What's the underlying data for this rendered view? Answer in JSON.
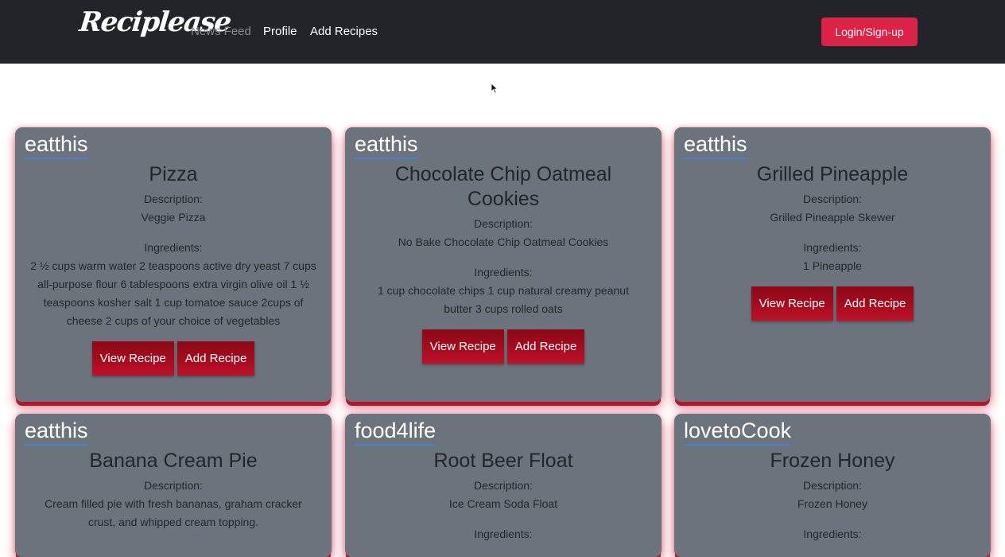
{
  "nav": {
    "brand": "Reciplease",
    "links": [
      "News Feed",
      "Profile",
      "Add Recipes"
    ],
    "login_label": "Login/Sign-up"
  },
  "recipes": [
    {
      "user": "eatthis",
      "title": "Pizza",
      "description_label": "Description:",
      "description": "Veggie Pizza",
      "ingredients_label": "Ingredients:",
      "ingredients": "2 ½ cups warm water 2 teaspoons active dry yeast 7 cups all-purpose flour 6 tablespoons extra virgin olive oil 1 ½ teaspoons kosher salt 1 cup tomatoe sauce 2cups of cheese 2 cups of your choice of vegetables",
      "view_label": "View Recipe",
      "add_label": "Add Recipe"
    },
    {
      "user": "eatthis",
      "title": "Chocolate Chip Oatmeal Cookies",
      "description_label": "Description:",
      "description": "No Bake Chocolate Chip Oatmeal Cookies",
      "ingredients_label": "Ingredients:",
      "ingredients": "1 cup chocolate chips 1 cup natural creamy peanut butter 3 cups rolled oats",
      "view_label": "View Recipe",
      "add_label": "Add Recipe"
    },
    {
      "user": "eatthis",
      "title": "Grilled Pineapple",
      "description_label": "Description:",
      "description": "Grilled Pineapple Skewer",
      "ingredients_label": "Ingredients:",
      "ingredients": "1 Pineapple",
      "view_label": "View Recipe",
      "add_label": "Add Recipe"
    },
    {
      "user": "eatthis",
      "title": "Banana Cream Pie",
      "description_label": "Description:",
      "description": "Cream filled pie with fresh bananas, graham cracker crust, and whipped cream topping."
    },
    {
      "user": "food4life",
      "title": "Root Beer Float",
      "description_label": "Description:",
      "description": "Ice Cream Soda Float",
      "ingredients_label": "Ingredients:"
    },
    {
      "user": "lovetoCook",
      "title": "Frozen Honey",
      "description_label": "Description:",
      "description": "Frozen Honey",
      "ingredients_label": "Ingredients:"
    }
  ]
}
